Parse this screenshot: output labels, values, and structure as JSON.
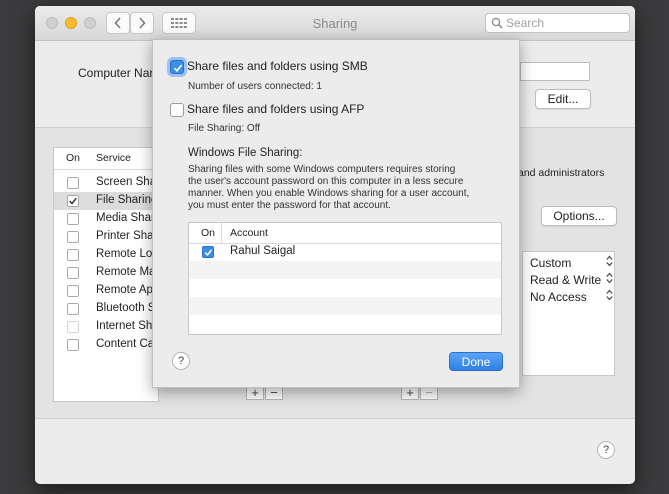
{
  "window": {
    "title": "Sharing",
    "search": {
      "placeholder": "Search",
      "value": ""
    },
    "grid_label": "⋮⋮⋮"
  },
  "main": {
    "computer_name_label": "Computer Nar",
    "edit_button": "Edit...",
    "services_header": {
      "on": "On",
      "service": "Service"
    },
    "services": [
      {
        "label": "Screen Sha",
        "checked": false
      },
      {
        "label": "File Sharing",
        "checked": true
      },
      {
        "label": "Media Shar",
        "checked": false
      },
      {
        "label": "Printer Sha",
        "checked": false
      },
      {
        "label": "Remote Log",
        "checked": false
      },
      {
        "label": "Remote Ma",
        "checked": false
      },
      {
        "label": "Remote App",
        "checked": false
      },
      {
        "label": "Bluetooth S",
        "checked": false
      },
      {
        "label": "Internet Sh",
        "checked": false
      },
      {
        "label": "Content Ca",
        "checked": false
      }
    ],
    "admin_text": "and administrators",
    "options_button": "Options...",
    "permissions": [
      "Custom",
      "Read & Write",
      "No Access"
    ],
    "plus": "+",
    "minus": "−",
    "help": "?"
  },
  "sheet": {
    "smb": {
      "label": "Share files and folders using SMB",
      "checked": true,
      "status": "Number of users connected: 1"
    },
    "afp": {
      "label": "Share files and folders using AFP",
      "checked": false,
      "status": "File Sharing: Off"
    },
    "windows_title": "Windows File Sharing:",
    "windows_desc": [
      "Sharing files with some Windows computers requires storing",
      "the user's account password on this computer in a less secure",
      "manner. When you enable Windows sharing for a user account,",
      "you must enter the password for that account."
    ],
    "table": {
      "headers": {
        "on": "On",
        "account": "Account"
      },
      "rows": [
        {
          "checked": true,
          "account": "Rahul Saigal"
        }
      ]
    },
    "help": "?",
    "done_button": "Done"
  },
  "colors": {
    "accent": "#3a8ee6",
    "close": "#fc5f57",
    "minimize": "#fdbc2e",
    "zoom": "#c8c8c8"
  }
}
